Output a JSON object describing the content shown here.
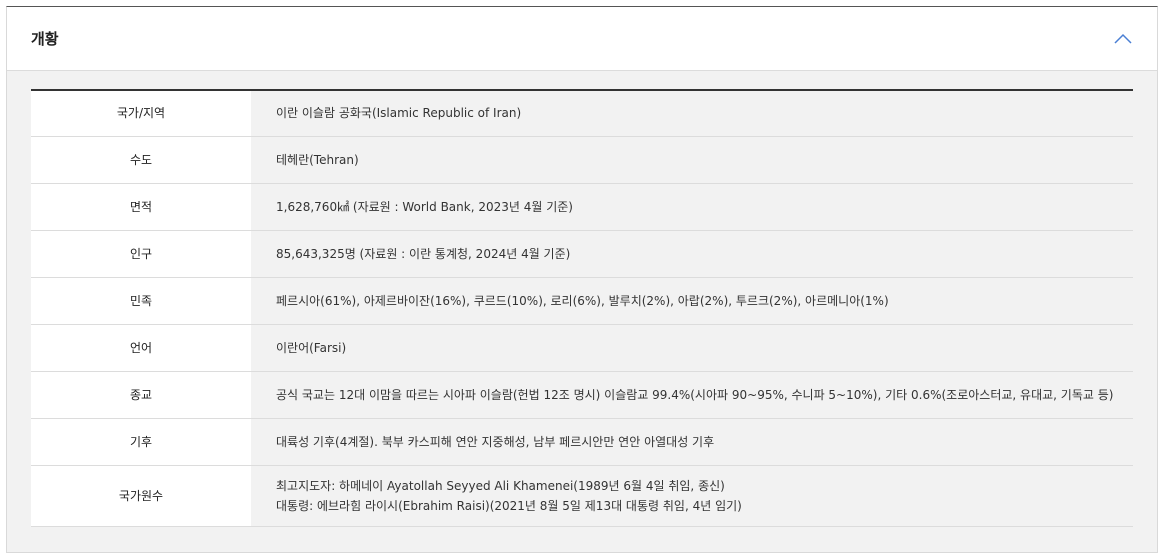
{
  "header": {
    "title": "개황",
    "toggle_icon": "chevron-up-icon"
  },
  "rows": [
    {
      "label": "국가/지역",
      "value": "이란 이슬람 공화국(Islamic Republic of Iran)"
    },
    {
      "label": "수도",
      "value": "테헤란(Tehran)"
    },
    {
      "label": "면적",
      "value": "1,628,760㎢ (자료원 : World Bank, 2023년 4월 기준)"
    },
    {
      "label": "인구",
      "value": "85,643,325명 (자료원 : 이란 통계청, 2024년 4월 기준)"
    },
    {
      "label": "민족",
      "value": "페르시아(61%), 아제르바이잔(16%), 쿠르드(10%), 로리(6%), 발루치(2%), 아랍(2%), 투르크(2%), 아르메니아(1%)"
    },
    {
      "label": "언어",
      "value": "이란어(Farsi)"
    },
    {
      "label": "종교",
      "value": "공식 국교는 12대 이맘을 따르는 시아파 이슬람(헌법 12조 명시) 이슬람교 99.4%(시아파 90~95%, 수니파 5~10%), 기타 0.6%(조로아스터교, 유대교, 기독교 등)"
    },
    {
      "label": "기후",
      "value": "대륙성 기후(4계절). 북부 카스피해 연안 지중해성, 남부  페르시안만 연안 아열대성 기후"
    },
    {
      "label": "국가원수",
      "lines": [
        "최고지도자: 하메네이 Ayatollah Seyyed Ali Khamenei(1989년 6월 4일 취임, 종신)",
        "대통령: 에브라힘 라이시(Ebrahim Raisi)(2021년 8월 5일 제13대 대통령 취임, 4년 임기)"
      ]
    }
  ]
}
